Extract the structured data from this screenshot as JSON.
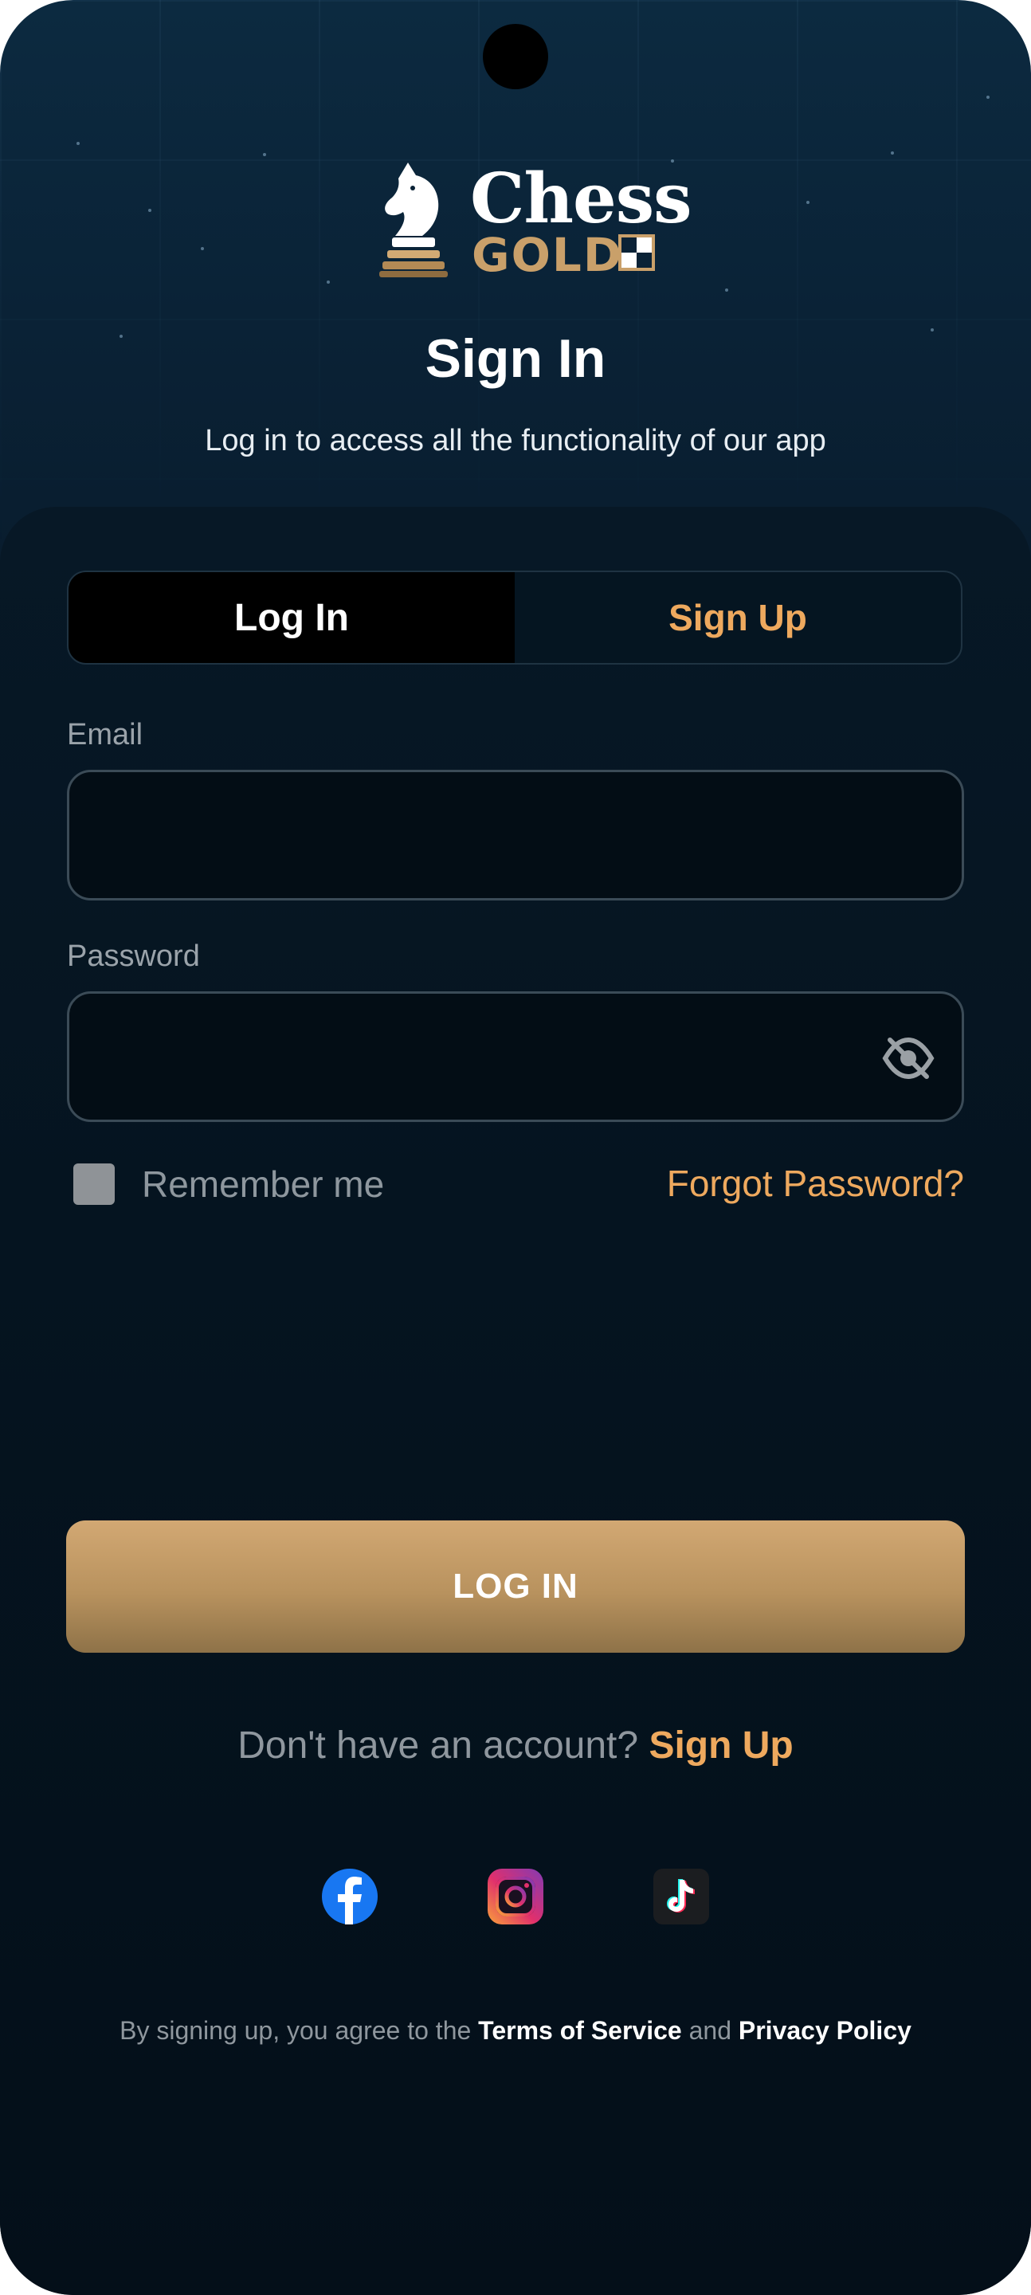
{
  "brand": {
    "name_top": "Chess",
    "name_bottom": "GOLD"
  },
  "header": {
    "title": "Sign In",
    "subtitle": "Log in to access all the functionality of our app"
  },
  "tabs": [
    {
      "label": "Log In",
      "active": true
    },
    {
      "label": "Sign Up",
      "active": false
    }
  ],
  "form": {
    "email": {
      "label": "Email",
      "value": "",
      "placeholder": ""
    },
    "password": {
      "label": "Password",
      "value": "",
      "placeholder": ""
    },
    "remember_label": "Remember me",
    "remember_checked": false,
    "forgot_label": "Forgot Password?"
  },
  "login_button": "LOG IN",
  "signup_prompt": {
    "text": "Don't have an account?",
    "link": "Sign Up"
  },
  "social": [
    {
      "icon": "facebook-icon",
      "color": "#1877f2"
    },
    {
      "icon": "instagram-icon",
      "color": "#d6249f"
    },
    {
      "icon": "tiktok-icon",
      "color": "#ffffff"
    }
  ],
  "legal": {
    "prefix": "By signing up, you agree to the",
    "terms": "Terms of Service",
    "and": "and",
    "privacy": "Privacy Policy"
  },
  "colors": {
    "accent": "#eea95e",
    "gold": "#c9a06a",
    "background": "#06131f"
  }
}
